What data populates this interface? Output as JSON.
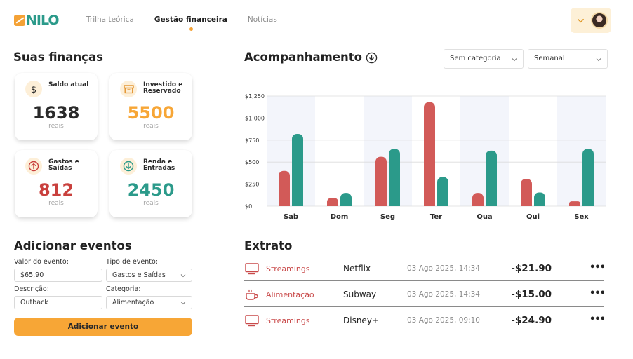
{
  "app": {
    "logo_text": "NILO"
  },
  "nav": {
    "items": [
      {
        "label": "Trilha teórica",
        "active": false
      },
      {
        "label": "Gestão financeira",
        "active": true
      },
      {
        "label": "Notícias",
        "active": false
      }
    ]
  },
  "colors": {
    "accent_orange": "#f7a636",
    "teal": "#2b9a8a",
    "red": "#d25a58",
    "bar_green": "#2b9a8a",
    "bar_red": "#d25a58"
  },
  "finances": {
    "title": "Suas finanças",
    "cards": [
      {
        "label": "Saldo atual",
        "value": "1638",
        "unit": "reais",
        "icon": "dollar-icon",
        "value_color": "#2a2a2a"
      },
      {
        "label": "Investido e Reservado",
        "value": "5500",
        "unit": "reais",
        "icon": "archive-box-icon",
        "value_color": "#f7a636"
      },
      {
        "label": "Gastos e Saídas",
        "value": "812",
        "unit": "reais",
        "icon": "arrow-up-circle-icon",
        "value_color": "#c9403d"
      },
      {
        "label": "Renda e Entradas",
        "value": "2450",
        "unit": "reais",
        "icon": "arrow-down-circle-icon",
        "value_color": "#2b9a8a"
      }
    ]
  },
  "add_event": {
    "title": "Adicionar eventos",
    "value_label": "Valor do evento:",
    "value_input": "$65,90",
    "type_label": "Tipo de evento:",
    "type_selected": "Gastos e Saídas",
    "description_label": "Descrição:",
    "description_input": "Outback",
    "category_label": "Categoria:",
    "category_selected": "Alimentação",
    "submit_label": "Adicionar evento"
  },
  "tracking": {
    "title": "Acompanhamento",
    "category_filter": "Sem categoria",
    "period_filter": "Semanal"
  },
  "chart_data": {
    "type": "bar",
    "categories": [
      "Sab",
      "Dom",
      "Seg",
      "Ter",
      "Qua",
      "Qui",
      "Sex"
    ],
    "series": [
      {
        "values": [
          400,
          95,
          560,
          1180,
          150,
          310,
          55
        ],
        "color": "#d25a58"
      },
      {
        "values": [
          820,
          150,
          650,
          330,
          630,
          155,
          650
        ],
        "color": "#2b9a8a"
      }
    ],
    "yticks": [
      "$0",
      "$250",
      "$500",
      "$750",
      "$1,000",
      "$1,250"
    ],
    "ylim": [
      0,
      1250
    ],
    "grid": true,
    "legend": "none"
  },
  "statement": {
    "title": "Extrato",
    "rows": [
      {
        "category": "Streamings",
        "icon": "tv-icon",
        "merchant": "Netflix",
        "date": "03 Ago 2025, 14:34",
        "amount": "-$21.90"
      },
      {
        "category": "Alimentação",
        "icon": "coffee-cup-icon",
        "merchant": "Subway",
        "date": "03 Ago 2025, 14:34",
        "amount": "-$15.00"
      },
      {
        "category": "Streamings",
        "icon": "tv-icon",
        "merchant": "Disney+",
        "date": "03 Ago 2025, 09:10",
        "amount": "-$24.90"
      }
    ],
    "more_label": "•••"
  }
}
